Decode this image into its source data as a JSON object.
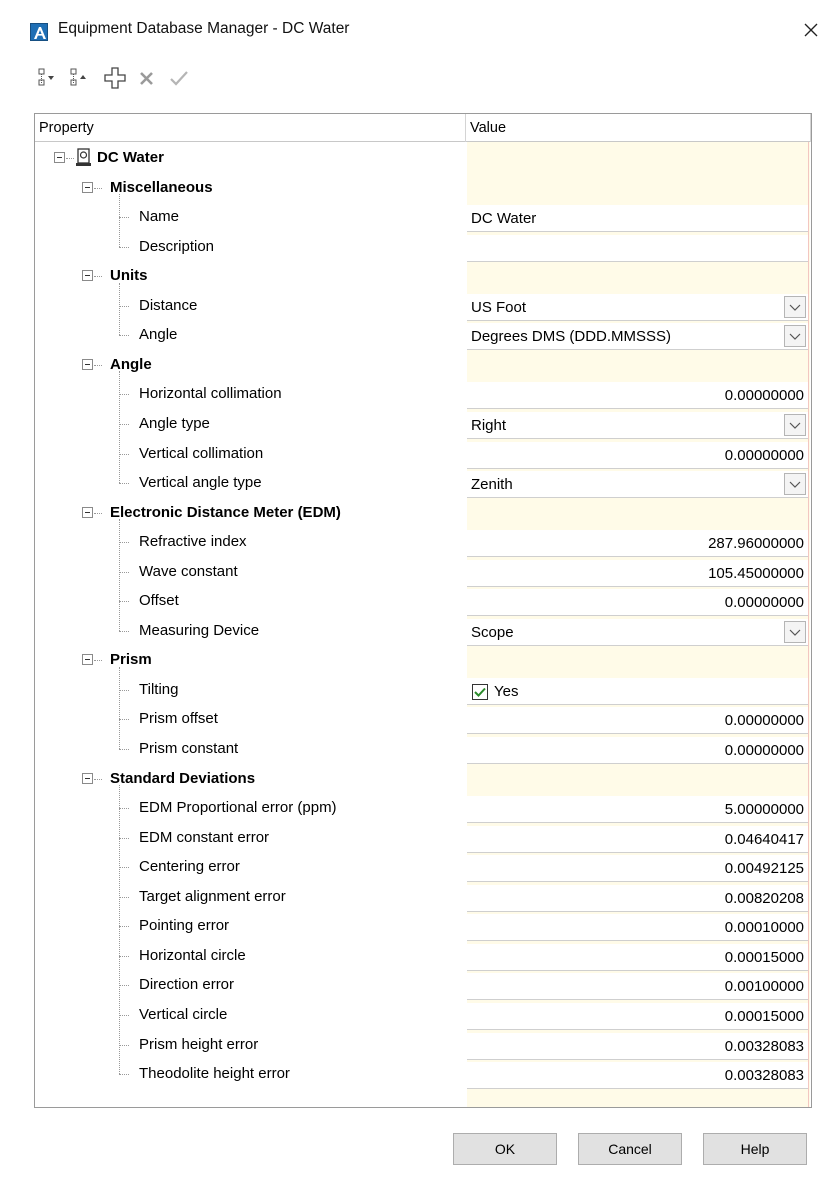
{
  "window": {
    "title": "Equipment Database Manager - DC Water"
  },
  "icons": {
    "app": "autocad-app-icon",
    "close": "close-icon",
    "collapse_all": "collapse-all-icon",
    "expand_all": "expand-all-icon",
    "add": "add-icon",
    "delete": "delete-icon",
    "apply": "checkmark-icon",
    "root": "instrument-icon"
  },
  "columns": {
    "property": "Property",
    "value": "Value"
  },
  "root": {
    "label": "DC Water"
  },
  "sections": [
    {
      "label": "Miscellaneous",
      "items": [
        {
          "label": "Name",
          "value": "DC Water",
          "type": "text"
        },
        {
          "label": "Description",
          "value": "",
          "type": "text"
        }
      ]
    },
    {
      "label": "Units",
      "items": [
        {
          "label": "Distance",
          "value": "US Foot",
          "type": "dropdown"
        },
        {
          "label": "Angle",
          "value": "Degrees DMS (DDD.MMSSS)",
          "type": "dropdown"
        }
      ]
    },
    {
      "label": "Angle",
      "items": [
        {
          "label": "Horizontal collimation",
          "value": "0.00000000",
          "type": "number"
        },
        {
          "label": "Angle type",
          "value": "Right",
          "type": "dropdown"
        },
        {
          "label": "Vertical collimation",
          "value": "0.00000000",
          "type": "number"
        },
        {
          "label": "Vertical angle type",
          "value": "Zenith",
          "type": "dropdown"
        }
      ]
    },
    {
      "label": "Electronic Distance Meter (EDM)",
      "items": [
        {
          "label": "Refractive index",
          "value": "287.96000000",
          "type": "number"
        },
        {
          "label": "Wave constant",
          "value": "105.45000000",
          "type": "number"
        },
        {
          "label": "Offset",
          "value": "0.00000000",
          "type": "number"
        },
        {
          "label": "Measuring Device",
          "value": "Scope",
          "type": "dropdown"
        }
      ]
    },
    {
      "label": "Prism",
      "items": [
        {
          "label": "Tilting",
          "value": "Yes",
          "type": "checkbox",
          "checked": true
        },
        {
          "label": "Prism offset",
          "value": "0.00000000",
          "type": "number"
        },
        {
          "label": "Prism constant",
          "value": "0.00000000",
          "type": "number"
        }
      ]
    },
    {
      "label": "Standard Deviations",
      "items": [
        {
          "label": "EDM Proportional error (ppm)",
          "value": "5.00000000",
          "type": "number"
        },
        {
          "label": "EDM constant error",
          "value": "0.04640417",
          "type": "number"
        },
        {
          "label": "Centering error",
          "value": "0.00492125",
          "type": "number"
        },
        {
          "label": "Target alignment error",
          "value": "0.00820208",
          "type": "number"
        },
        {
          "label": "Pointing error",
          "value": "0.00010000",
          "type": "number"
        },
        {
          "label": "Horizontal circle",
          "value": "0.00015000",
          "type": "number"
        },
        {
          "label": "Direction error",
          "value": "0.00100000",
          "type": "number"
        },
        {
          "label": "Vertical circle",
          "value": "0.00015000",
          "type": "number"
        },
        {
          "label": "Prism height error",
          "value": "0.00328083",
          "type": "number"
        },
        {
          "label": "Theodolite height error",
          "value": "0.00328083",
          "type": "number"
        }
      ]
    }
  ],
  "buttons": {
    "ok": "OK",
    "cancel": "Cancel",
    "help": "Help"
  },
  "colors": {
    "value_column_bg": "#fffbe8",
    "accent": "#1f6fb5",
    "check_green": "#2a8a2a"
  }
}
